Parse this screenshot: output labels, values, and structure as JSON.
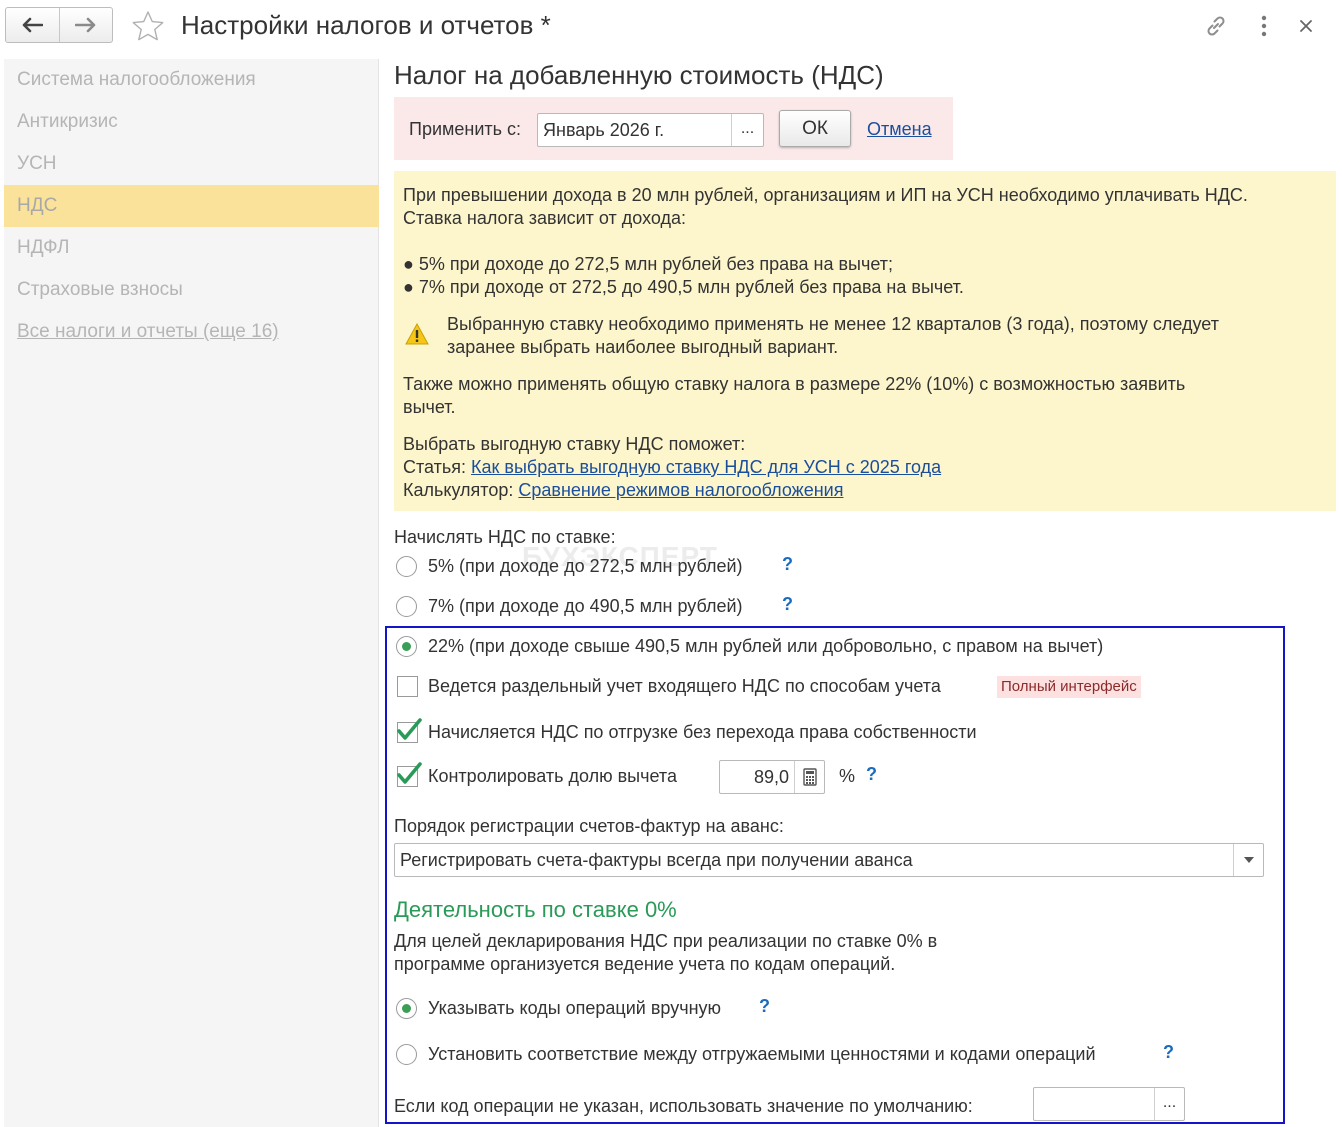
{
  "window": {
    "title": "Настройки налогов и отчетов *"
  },
  "icons": {
    "back": "arrow-left-icon",
    "forward": "arrow-right-icon",
    "favorite": "star-icon",
    "link": "link-icon",
    "more": "more-vertical-icon",
    "close": "close-icon",
    "warning": "warning-icon",
    "calculator": "calculator-icon",
    "dropdown": "chevron-down-icon",
    "checkmark": "checkmark-icon"
  },
  "colors": {
    "active_nav": "#fbe29a",
    "info_bg": "#fdf6cc",
    "apply_bg": "#fbe9ea",
    "accent_green": "#2a9a58",
    "link": "#1b4e9b",
    "highlight_border": "#1414c8"
  },
  "sidebar": {
    "items": [
      {
        "label": "Система налогообложения"
      },
      {
        "label": "Антикризис"
      },
      {
        "label": "УСН"
      },
      {
        "label": "НДС"
      },
      {
        "label": "НДФЛ"
      },
      {
        "label": "Страховые взносы"
      },
      {
        "label": "Все налоги и отчеты (еще 16)"
      }
    ],
    "active": "НДС"
  },
  "main": {
    "heading": "Налог на добавленную стоимость (НДС)",
    "apply": {
      "label": "Применить с:",
      "value": "Январь 2026 г.",
      "picker": "...",
      "ok_label": "ОК",
      "cancel_label": "Отмена"
    },
    "info": {
      "line1": "При превышении дохода в 20 млн рублей, организациям и ИП на УСН необходимо уплачивать НДС.",
      "line2": "Ставка налога зависит от дохода:",
      "bullet1": "● 5% при доходе до 272,5 млн рублей без права на вычет;",
      "bullet2": "● 7% при доходе от 272,5 до 490,5 млн рублей без права на вычет.",
      "warning1": "Выбранную ставку необходимо применять не менее 12 кварталов (3 года), поэтому следует",
      "warning2": "заранее выбрать наиболее выгодный вариант.",
      "general1": "Также можно применять общую ставку налога в размере 22% (10%) с возможностью заявить",
      "general2": "вычет.",
      "help_intro": "Выбрать выгодную ставку НДС поможет:",
      "article_label": "Статья:",
      "article_link": "Как выбрать выгодную ставку НДС для УСН с 2025 года",
      "calc_label": "Калькулятор:",
      "calc_link": "Сравнение режимов налогообложения"
    },
    "rate": {
      "label": "Начислять НДС по ставке:",
      "options": [
        {
          "label": "5% (при доходе до 272,5 млн рублей)",
          "selected": false,
          "help": "?"
        },
        {
          "label": "7% (при доходе до 490,5 млн рублей)",
          "selected": false,
          "help": "?"
        },
        {
          "label": "22% (при доходе свыше 490,5 млн рублей или добровольно, с правом на вычет)",
          "selected": true
        }
      ]
    },
    "checks": {
      "separate": {
        "label": "Ведется раздельный учет входящего НДС по способам учета",
        "checked": false,
        "badge": "Полный интерфейс"
      },
      "shipment": {
        "label": "Начисляется НДС по отгрузке без перехода права собственности",
        "checked": true
      },
      "control": {
        "label": "Контролировать долю вычета",
        "checked": true,
        "value": "89,0",
        "unit": "%",
        "help": "?"
      }
    },
    "invoice": {
      "label": "Порядок регистрации счетов-фактур на аванс:",
      "value": "Регистрировать счета-фактуры всегда при получении аванса"
    },
    "zero_rate": {
      "heading": "Деятельность по ставке 0%",
      "desc1": "Для целей декларирования НДС при реализации по ставке 0% в",
      "desc2": "программе организуется ведение учета по кодам операций.",
      "options": [
        {
          "label": "Указывать коды операций вручную",
          "selected": true,
          "help": "?"
        },
        {
          "label": "Установить соответствие между отгружаемыми ценностями и кодами операций",
          "selected": false,
          "help": "?"
        }
      ],
      "default_label": "Если код операции не указан, использовать значение по умолчанию:",
      "default_value": "",
      "default_picker": "..."
    },
    "watermark": "БУХЭКСПЕРТ"
  }
}
